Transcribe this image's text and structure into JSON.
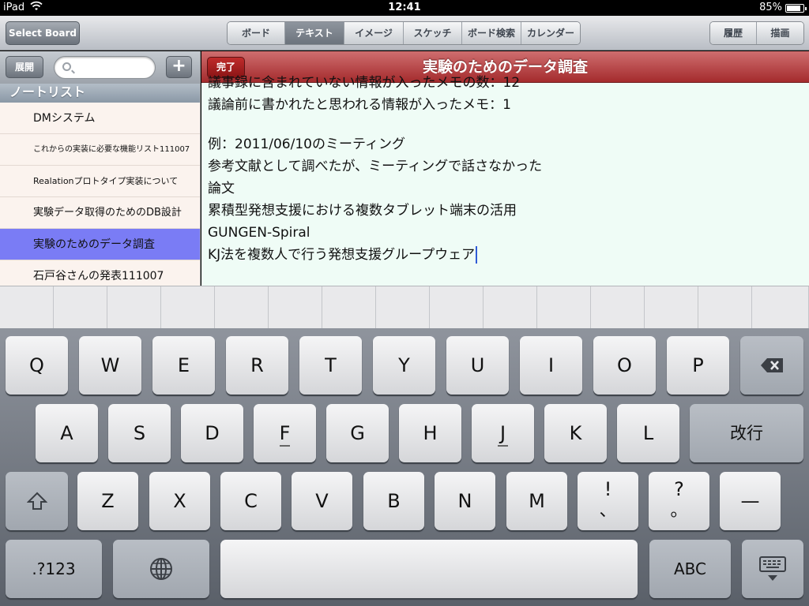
{
  "status": {
    "carrier": "iPad",
    "time": "12:41",
    "battery": "85%",
    "battery_level": 85
  },
  "toolbar": {
    "select_board": "Select Board",
    "tabs": [
      "ボード",
      "テキスト",
      "イメージ",
      "スケッチ",
      "ボード検索",
      "カレンダー"
    ],
    "selected_tab": "テキスト",
    "right_buttons": [
      "履歴",
      "描画"
    ]
  },
  "sidebar": {
    "expand_label": "展開",
    "search_placeholder": "",
    "add_label": "+",
    "list_header": "ノートリスト",
    "notes": [
      "DMシステム",
      "これからの実装に必要な機能リスト111007",
      "Realationプロトタイプ実装について",
      "実験データ取得のためのDB設計",
      "実験のためのデータ調査",
      "石戸谷さんの発表111007"
    ],
    "selected_note": "実験のためのデータ調査"
  },
  "editor": {
    "done_label": "完了",
    "title": "実験のためのデータ調査",
    "lines": [
      "議事録に含まれていない情報が入ったメモの数：12",
      "議論前に書かれたと思われる情報が入ったメモ：1",
      "",
      "例：2011/06/10のミーティング",
      "参考文献として調べたが、ミーティングで話さなかった",
      "論文",
      "累積型発想支援における複数タブレット端末の活用",
      "GUNGEN-Spiral",
      "KJ法を複数人で行う発想支援グループウェア"
    ]
  },
  "keyboard": {
    "row1": [
      "Q",
      "W",
      "E",
      "R",
      "T",
      "Y",
      "U",
      "I",
      "O",
      "P"
    ],
    "row2": [
      "A",
      "S",
      "D",
      "F",
      "G",
      "H",
      "J",
      "K",
      "L"
    ],
    "row3": [
      "Z",
      "X",
      "C",
      "V",
      "B",
      "N",
      "M"
    ],
    "return_label": "改行",
    "exclaim_top": "!",
    "exclaim_bottom": "、",
    "question_top": "?",
    "question_bottom": "。",
    "dash": "—",
    "numbers_label": ".?123",
    "abc_label": "ABC"
  }
}
